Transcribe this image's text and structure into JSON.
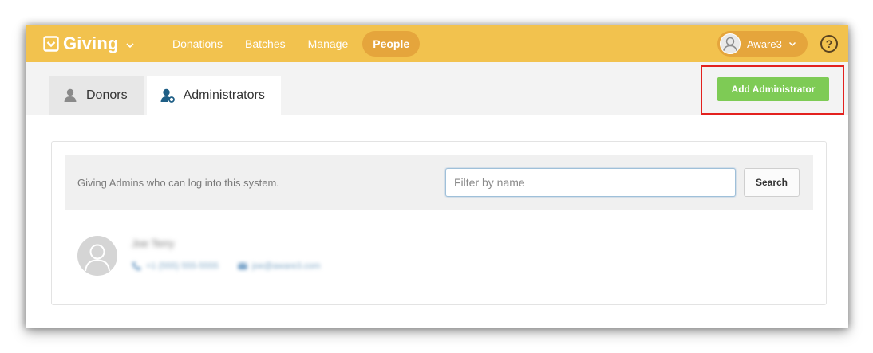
{
  "app": {
    "name": "Giving",
    "colors": {
      "header": "#f2c24e",
      "header_pill": "#e5a53c",
      "primary_button": "#7ecb55",
      "highlight_box": "#e3211e"
    }
  },
  "nav": {
    "items": [
      {
        "label": "Donations",
        "active": false
      },
      {
        "label": "Batches",
        "active": false
      },
      {
        "label": "Manage",
        "active": false
      },
      {
        "label": "People",
        "active": true
      }
    ]
  },
  "user_menu": {
    "name": "Aware3",
    "icon": "chevron-down-icon"
  },
  "help": {
    "label": "?"
  },
  "tabs": [
    {
      "label": "Donors",
      "icon": "person-icon",
      "active": false
    },
    {
      "label": "Administrators",
      "icon": "admin-person-icon",
      "active": true
    }
  ],
  "actions": {
    "add_admin_label": "Add Administrator"
  },
  "filter": {
    "description": "Giving Admins who can log into this system.",
    "placeholder": "Filter by name",
    "value": "",
    "search_label": "Search"
  },
  "admins": [
    {
      "name": "Joe Terry",
      "phone": "+1 (555) 555-5555",
      "email": "joe@aware3.com",
      "redacted": true
    }
  ]
}
